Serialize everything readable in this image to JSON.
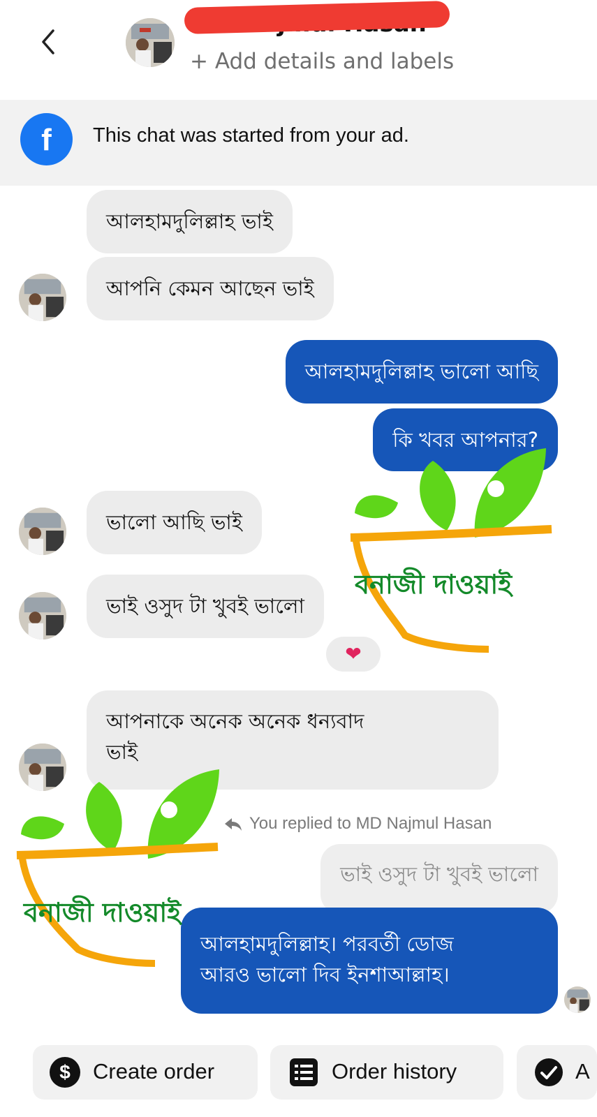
{
  "header": {
    "contact_name": "MD Najmul Hasan",
    "add_details_label": "+ Add details and labels"
  },
  "banner": {
    "text": "This chat was started from your ad."
  },
  "messages": [
    {
      "direction": "incoming",
      "text": "আলহামদুলিল্লাহ ভাই"
    },
    {
      "direction": "incoming",
      "text": "আপনি কেমন আছেন ভাই"
    },
    {
      "direction": "outgoing",
      "text": "আলহামদুলিল্লাহ ভালো আছি"
    },
    {
      "direction": "outgoing",
      "text": "কি খবর আপনার?"
    },
    {
      "direction": "incoming",
      "text": "ভালো আছি ভাই"
    },
    {
      "direction": "incoming",
      "text": "ভাই ওসুদ টা খুবই ভালো",
      "reaction": "❤"
    },
    {
      "direction": "incoming",
      "lines": [
        "আপনাকে অনেক অনেক ধন্যবাদ",
        "ভাই"
      ]
    },
    {
      "direction": "outgoing",
      "reply_note": "You replied to MD Najmul Hasan",
      "quoted": "ভাই ওসুদ টা খুবই ভালো",
      "lines": [
        "আলহামদুলিল্লাহ।  পরবর্তী ডোজ",
        "আরও ভালো দিব ইনশাআল্লাহ।"
      ]
    }
  ],
  "watermark": {
    "text": "বনাজী দাওয়াই"
  },
  "actions": [
    {
      "label": "Create order",
      "icon": "dollar-icon",
      "glyph": "$"
    },
    {
      "label": "Order history",
      "icon": "receipt-icon"
    },
    {
      "label": "A",
      "icon": "check-circle-icon"
    }
  ]
}
